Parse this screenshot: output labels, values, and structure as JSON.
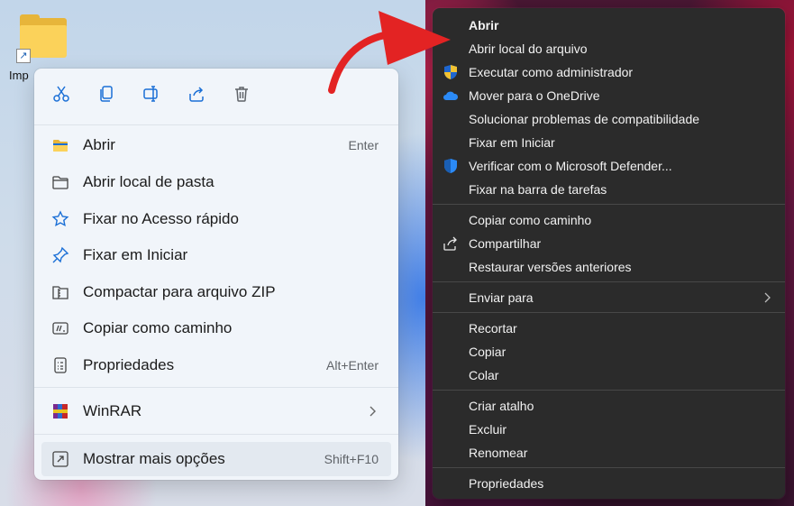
{
  "desktop_left": {
    "folder_label": "Imp"
  },
  "light_menu": {
    "quick_actions": [
      {
        "icon": "cut-icon"
      },
      {
        "icon": "copy-icon"
      },
      {
        "icon": "rename-icon"
      },
      {
        "icon": "share-icon"
      },
      {
        "icon": "trash-icon"
      }
    ],
    "items": [
      {
        "label": "Abrir",
        "shortcut": "Enter",
        "icon": "folder-icon"
      },
      {
        "label": "Abrir local de pasta",
        "shortcut": "",
        "icon": "folder-outline-icon"
      },
      {
        "label": "Fixar no Acesso rápido",
        "shortcut": "",
        "icon": "star-icon"
      },
      {
        "label": "Fixar em Iniciar",
        "shortcut": "",
        "icon": "pin-icon"
      },
      {
        "label": "Compactar para arquivo ZIP",
        "shortcut": "",
        "icon": "zip-icon"
      },
      {
        "label": "Copiar como caminho",
        "shortcut": "",
        "icon": "path-icon"
      },
      {
        "label": "Propriedades",
        "shortcut": "Alt+Enter",
        "icon": "properties-icon"
      },
      {
        "label": "WinRAR",
        "shortcut": "",
        "icon": "winrar-icon"
      },
      {
        "label": "Mostrar mais opções",
        "shortcut": "Shift+F10",
        "icon": "more-options-icon"
      }
    ]
  },
  "dark_menu": {
    "items": [
      {
        "label": "Abrir",
        "bold": true
      },
      {
        "label": "Abrir local do arquivo"
      },
      {
        "label": "Executar como administrador",
        "icon": "uac-shield-icon"
      },
      {
        "label": "Mover para o OneDrive",
        "icon": "onedrive-icon"
      },
      {
        "label": "Solucionar problemas de compatibilidade"
      },
      {
        "label": "Fixar em Iniciar"
      },
      {
        "label": "Verificar com o Microsoft Defender...",
        "icon": "defender-icon"
      },
      {
        "label": "Fixar na barra de tarefas"
      },
      {
        "label": "Copiar como caminho"
      },
      {
        "label": "Compartilhar",
        "icon": "share-icon"
      },
      {
        "label": "Restaurar versões anteriores"
      },
      {
        "label": "Enviar para",
        "submenu": true
      },
      {
        "label": "Recortar"
      },
      {
        "label": "Copiar"
      },
      {
        "label": "Colar"
      },
      {
        "label": "Criar atalho"
      },
      {
        "label": "Excluir"
      },
      {
        "label": "Renomear"
      },
      {
        "label": "Propriedades"
      }
    ]
  },
  "colors": {
    "light_menu_bg": "#f1f5fa",
    "dark_menu_bg": "#2b2b2b",
    "accent_blue": "#1a6fd6",
    "arrow_red": "#e32323"
  }
}
